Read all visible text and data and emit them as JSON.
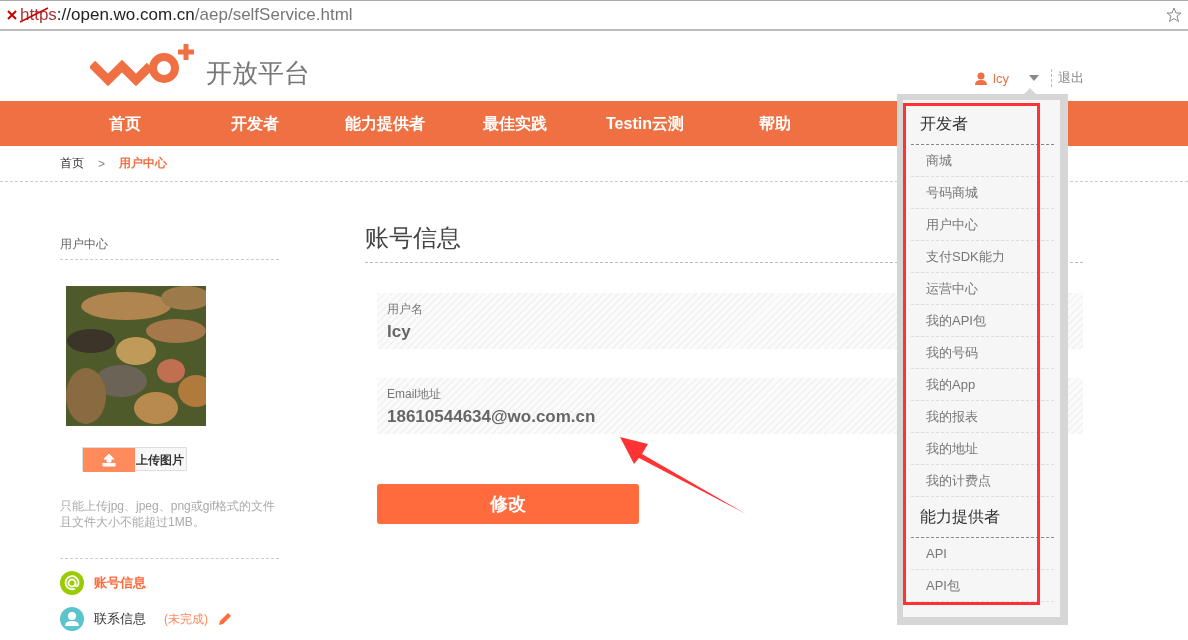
{
  "address_bar": {
    "scheme": "https",
    "host": "://open.wo.com.cn",
    "path": "/aep/selfService.html",
    "secure": false
  },
  "header": {
    "site_name": "开放平台",
    "user": "lcy",
    "logout": "退出"
  },
  "nav": [
    "首页",
    "开发者",
    "能力提供者",
    "最佳实践",
    "Testin云测",
    "帮助"
  ],
  "breadcrumb": {
    "items": [
      "首页",
      "用户中心"
    ],
    "separator": ">"
  },
  "sidebar": {
    "title": "用户中心",
    "upload_button": "上传图片",
    "hint": "只能上传jpg、jpeg、png或gif格式的文件且文件大小不能超过1MB。",
    "menu": [
      {
        "kind": "account",
        "label": "账号信息",
        "selected": true
      },
      {
        "kind": "contact",
        "label": "联系信息",
        "note": "(未完成)",
        "selected": false
      }
    ]
  },
  "main": {
    "title": "账号信息",
    "fields": [
      {
        "label": "用户名",
        "value": "lcy"
      },
      {
        "label": "Email地址",
        "value": "18610544634@wo.com.cn"
      }
    ],
    "button": "修改"
  },
  "dropdown": [
    {
      "title": "开发者",
      "items": [
        "商城",
        "号码商城",
        "用户中心",
        "支付SDK能力",
        "运营中心",
        "我的API包",
        "我的号码",
        "我的App",
        "我的报表",
        "我的地址",
        "我的计费点"
      ]
    },
    {
      "title": "能力提供者",
      "items": [
        "API",
        "API包"
      ]
    }
  ]
}
